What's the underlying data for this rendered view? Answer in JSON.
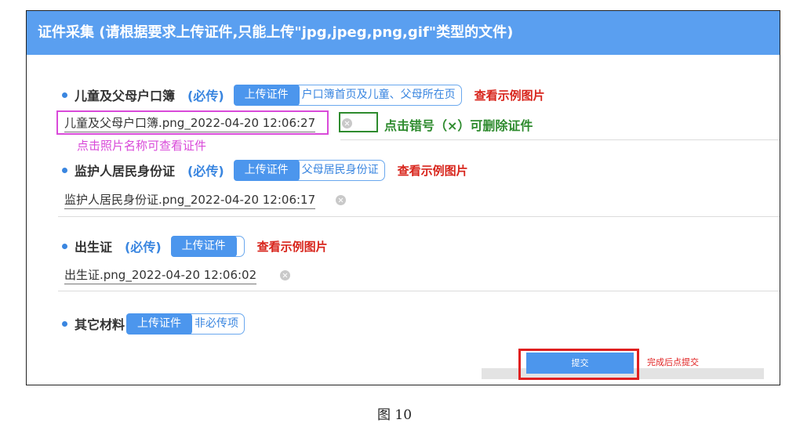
{
  "header": {
    "title": "证件采集 (请根据要求上传证件,只能上传\"jpg,jpeg,png,gif\"类型的文件)"
  },
  "sections": [
    {
      "title": "儿童及父母户口簿",
      "required": "(必传)",
      "upload_label": "上传证件",
      "hint": "户口簿首页及儿童、父母所在页",
      "example": "查看示例图片",
      "file": "儿童及父母户口簿.png_2022-04-20 12:06:27"
    },
    {
      "title": "监护人居民身份证",
      "required": "(必传)",
      "upload_label": "上传证件",
      "hint": "父母居民身份证",
      "example": "查看示例图片",
      "file": "监护人居民身份证.png_2022-04-20 12:06:17"
    },
    {
      "title": "出生证",
      "required": "(必传)",
      "upload_label": "上传证件",
      "hint": "",
      "example": "查看示例图片",
      "file": "出生证.png_2022-04-20 12:06:02"
    },
    {
      "title": "其它材料",
      "upload_label": "上传证件",
      "hint": "非必传项"
    }
  ],
  "annotations": {
    "delete_hint": "点击错号（×）可删除证件",
    "view_hint": "点击照片名称可查看证件",
    "submit_hint": "完成后点提交"
  },
  "submit_label": "提交",
  "caption": "图 10",
  "colors": {
    "header": "#5a9ff0",
    "accent": "#3a86e0",
    "example_red": "#d8261d",
    "annotation_pink": "#d94ad9",
    "annotation_green": "#2e8b2e",
    "annotation_red": "#e02020"
  },
  "icons": [
    "delete-icon",
    "bullet-dot"
  ]
}
